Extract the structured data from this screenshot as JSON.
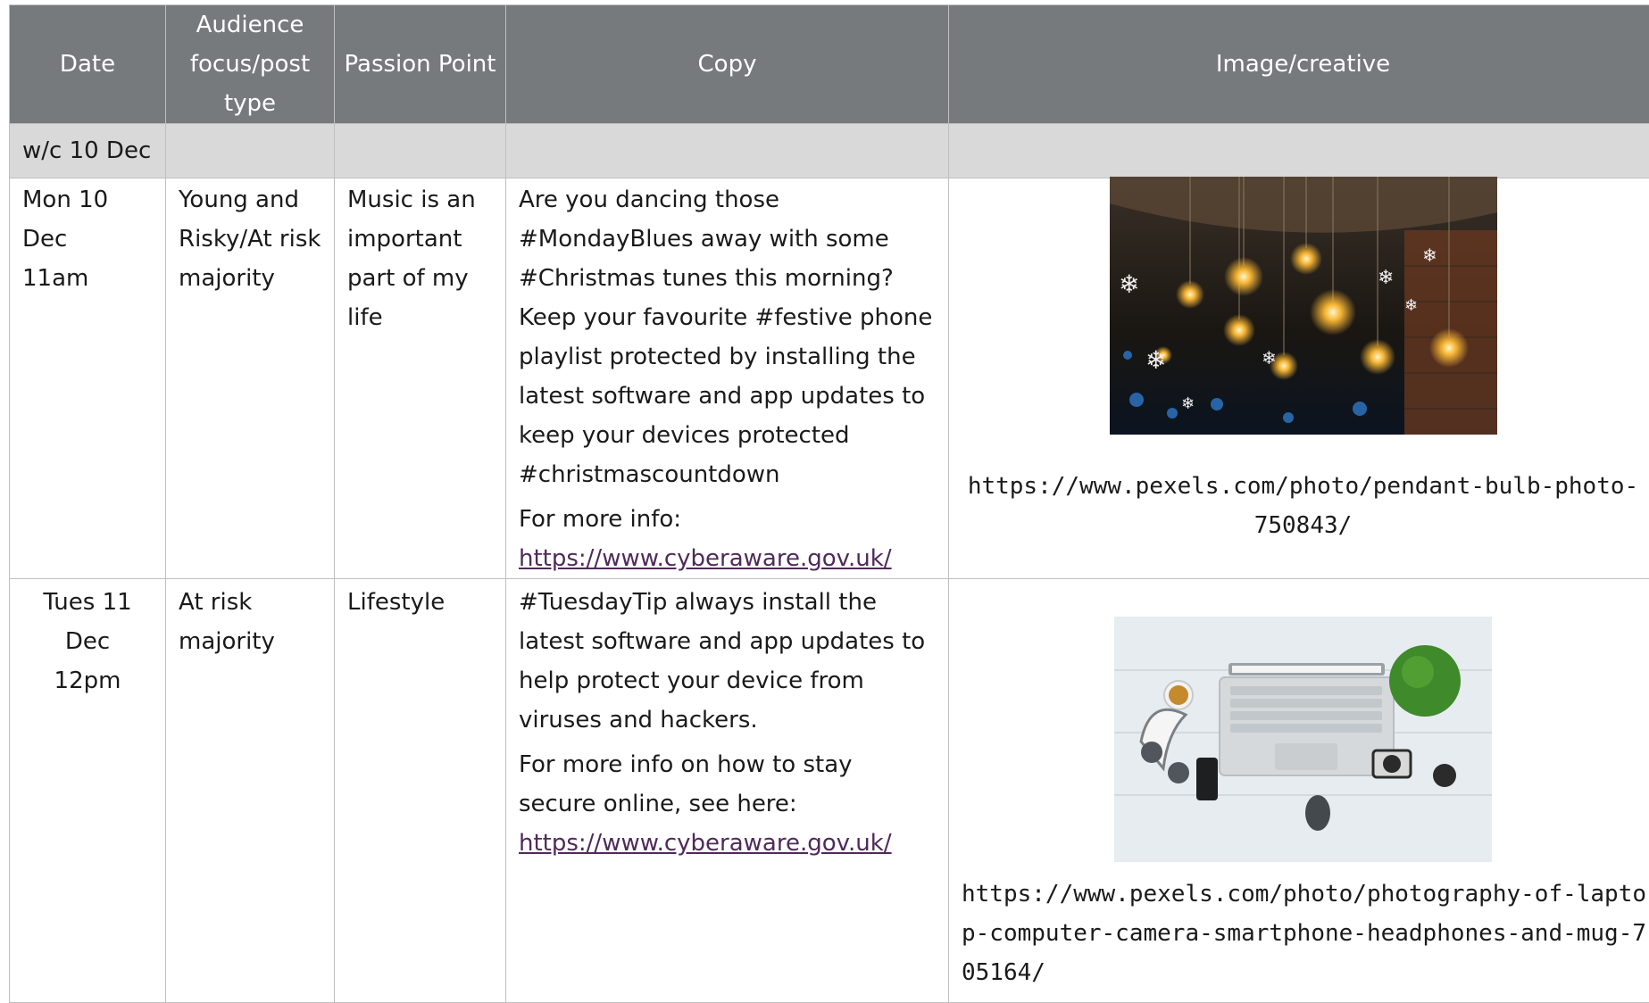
{
  "headers": {
    "date": "Date",
    "audience": "Audience focus/post type",
    "passion": "Passion Point",
    "copy": "Copy",
    "image": "Image/creative"
  },
  "week": {
    "label": "w/c 10 Dec"
  },
  "rows": [
    {
      "date": "Mon 10 Dec",
      "time": "11am",
      "audience": "Young and Risky/At risk majority",
      "passion": "Music is an important part of my life",
      "copy_main": "Are you dancing those #MondayBlues away with some #Christmas tunes this morning? Keep your favourite #festive phone playlist protected by installing the latest software and app updates to keep your devices protected #christmascountdown",
      "copy_more": "For more info:",
      "link": "https://www.cyberaware.gov.uk/",
      "image_icon": "christmas-bulbs-photo",
      "image_url": "https://www.pexels.com/photo/pendant-bulb-photo-750843/"
    },
    {
      "date": "Tues 11 Dec",
      "time": "12pm",
      "audience": "At risk majority",
      "passion": "Lifestyle",
      "copy_main": "#TuesdayTip always install the latest software and app updates to help protect your device from viruses and hackers.",
      "copy_more": "For more info on how to stay secure online, see here:",
      "link": "https://www.cyberaware.gov.uk/",
      "image_icon": "laptop-desk-photo",
      "image_url": "https://www.pexels.com/photo/photography-of-laptop-computer-camera-smartphone-headphones-and-mug-705164/"
    }
  ],
  "colors": {
    "header_bg": "#767a7d",
    "week_bg": "#d9d9d9",
    "link": "#4f2a5a"
  }
}
